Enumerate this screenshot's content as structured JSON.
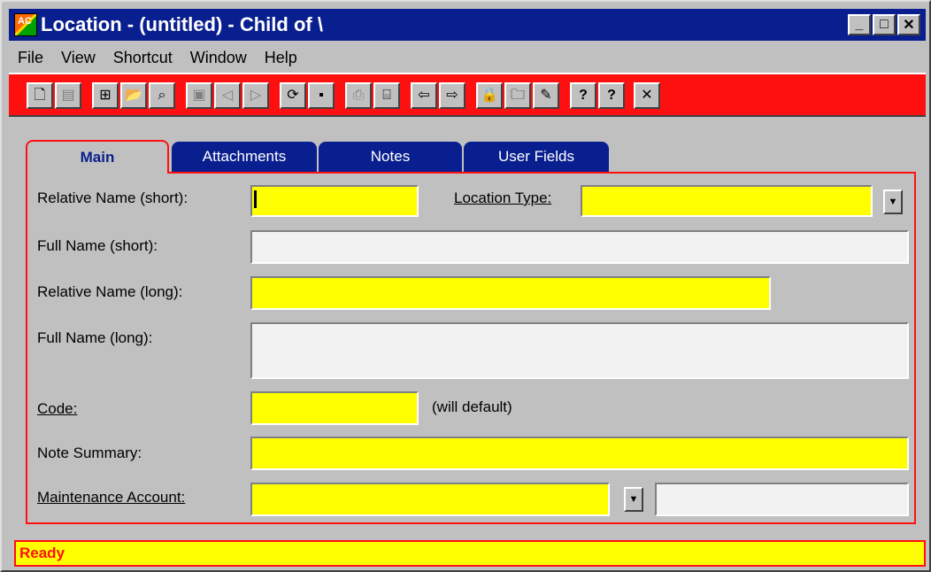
{
  "window": {
    "title": "Location - (untitled) - Child of \\",
    "icon": "app-icon",
    "controls": {
      "minimize": "_",
      "maximize": "□",
      "close": "✕"
    }
  },
  "menu": {
    "items": [
      "File",
      "View",
      "Shortcut",
      "Window",
      "Help"
    ]
  },
  "toolbar": {
    "colors": {
      "background": "#ff1010"
    },
    "buttons": [
      {
        "icon": "new-document-icon",
        "glyph": "🗋"
      },
      {
        "icon": "copy-record-icon",
        "glyph": "▤"
      },
      {
        "icon": "tree-view-icon",
        "glyph": "⊞"
      },
      {
        "icon": "open-folder-icon",
        "glyph": "📂"
      },
      {
        "icon": "search-records-icon",
        "glyph": "⌕"
      },
      {
        "icon": "first-record-icon",
        "glyph": "▣"
      },
      {
        "icon": "previous-record-icon",
        "glyph": "◁"
      },
      {
        "icon": "next-record-icon",
        "glyph": "▷"
      },
      {
        "icon": "refresh-icon",
        "glyph": "⟳"
      },
      {
        "icon": "save-icon",
        "glyph": "▪"
      },
      {
        "icon": "print-icon",
        "glyph": "⎙"
      },
      {
        "icon": "print-preview-icon",
        "glyph": "⌸"
      },
      {
        "icon": "back-icon",
        "glyph": "⇦"
      },
      {
        "icon": "forward-icon",
        "glyph": "⇨"
      },
      {
        "icon": "lock-icon",
        "glyph": "🔒"
      },
      {
        "icon": "folder-icon",
        "glyph": "🗀"
      },
      {
        "icon": "delete-icon",
        "glyph": "✎"
      },
      {
        "icon": "help-icon",
        "glyph": "?"
      },
      {
        "icon": "context-help-icon",
        "glyph": "?"
      },
      {
        "icon": "close-icon",
        "glyph": "✕"
      }
    ]
  },
  "tabs": [
    {
      "label": "Main",
      "active": true
    },
    {
      "label": "Attachments",
      "active": false
    },
    {
      "label": "Notes",
      "active": false
    },
    {
      "label": "User Fields",
      "active": false
    }
  ],
  "form": {
    "relative_name_short": {
      "label": "Relative Name (short):",
      "value": ""
    },
    "location_type": {
      "label": "Location Type:",
      "value": ""
    },
    "full_name_short": {
      "label": "Full Name (short):",
      "value": ""
    },
    "relative_name_long": {
      "label": "Relative Name (long):",
      "value": ""
    },
    "full_name_long": {
      "label": "Full Name (long):",
      "value": ""
    },
    "code": {
      "label": "Code:",
      "value": "",
      "hint": "(will default)"
    },
    "note_summary": {
      "label": "Note Summary:",
      "value": ""
    },
    "maintenance_account": {
      "label": "Maintenance Account:",
      "value": "",
      "description": ""
    }
  },
  "status": {
    "text": "Ready"
  },
  "colors": {
    "required_field": "#ffff00",
    "accent_red": "#ff1010",
    "title_blue": "#0a1f8f"
  }
}
